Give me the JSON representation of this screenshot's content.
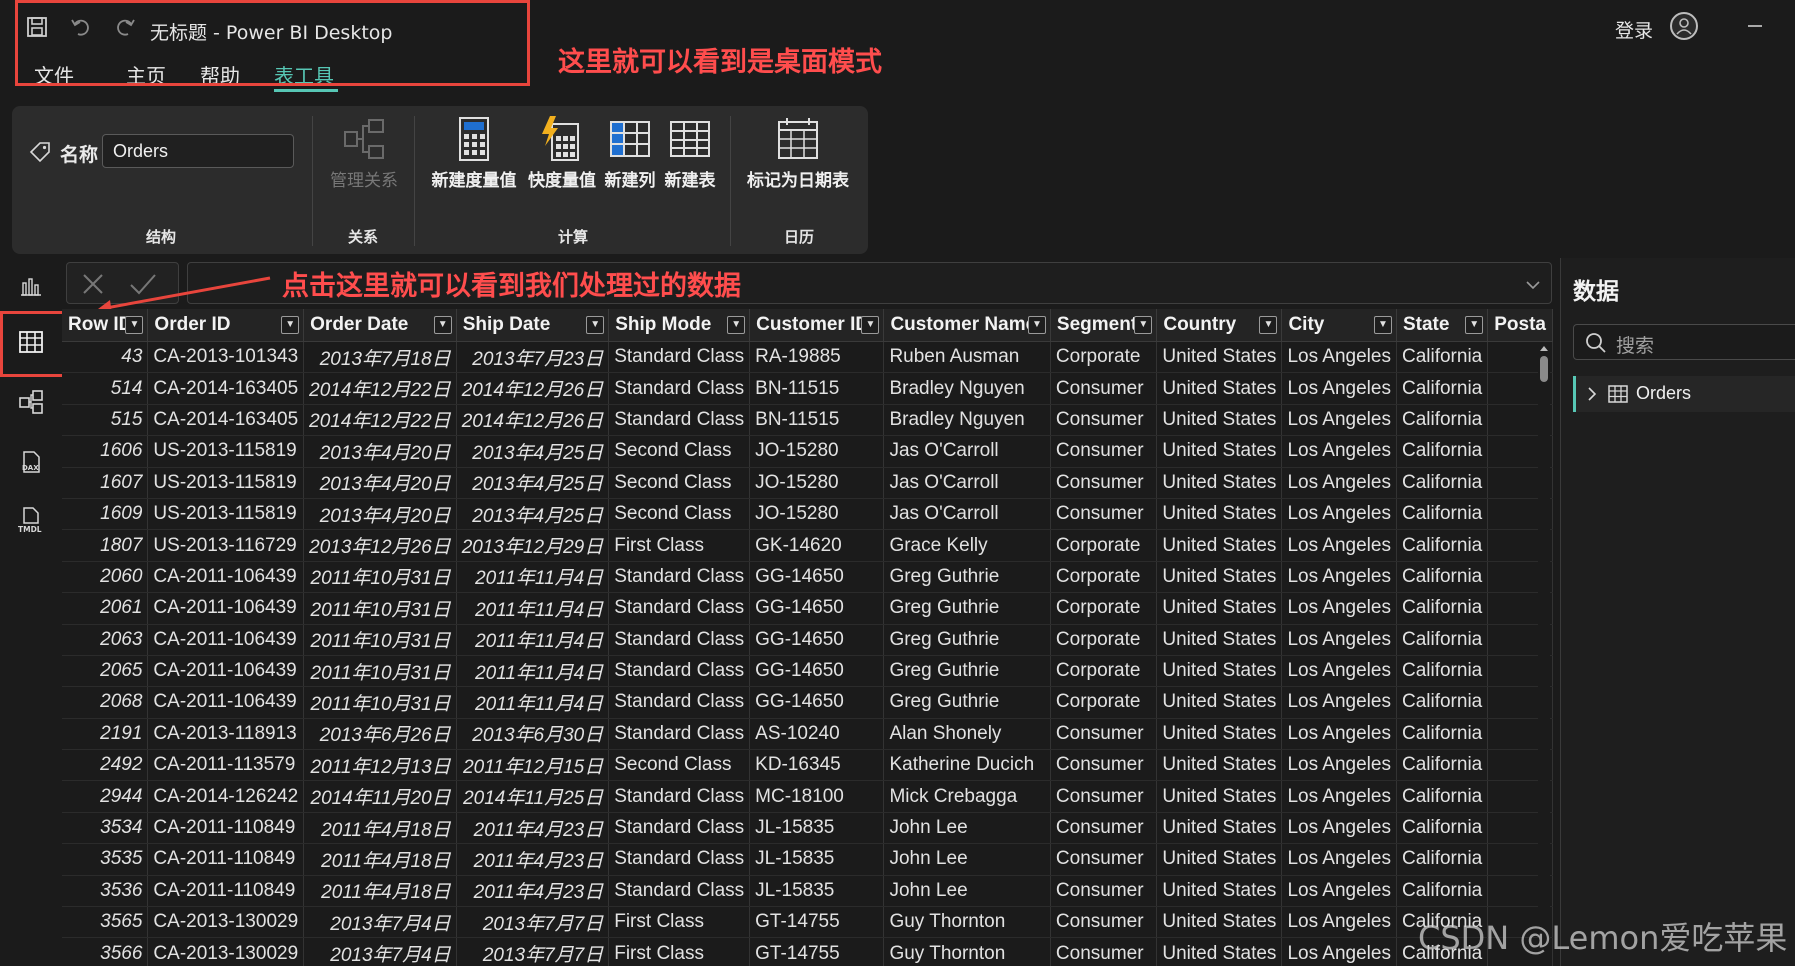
{
  "titlebar": {
    "app_title": "无标题 - Power BI Desktop",
    "login": "登录",
    "menu": [
      "文件",
      "主页",
      "帮助",
      "表工具"
    ]
  },
  "annotations": {
    "desktop_mode": "这里就可以看到是桌面模式",
    "click_here": "点击这里就可以看到我们处理过的数据"
  },
  "ribbon": {
    "name_label": "名称",
    "name_value": "Orders",
    "buttons": {
      "manage_relations": "管理关系",
      "new_measure": "新建度量值",
      "quick_measure": "快度量值",
      "new_column": "新建列",
      "new_table": "新建表",
      "mark_date": "标记为日期表"
    },
    "groups": {
      "structure": "结构",
      "relations": "关系",
      "calc": "计算",
      "calendar": "日历"
    }
  },
  "right_panel": {
    "title": "数据",
    "search_placeholder": "搜索",
    "table_name": "Orders"
  },
  "grid": {
    "columns": [
      "Row ID",
      "Order ID",
      "Order Date",
      "Ship Date",
      "Ship Mode",
      "Customer ID",
      "Customer Name",
      "Segment",
      "Country",
      "City",
      "State",
      "Posta"
    ],
    "rows": [
      [
        "43",
        "CA-2013-101343",
        "2013年7月18日",
        "2013年7月23日",
        "Standard Class",
        "RA-19885",
        "Ruben Ausman",
        "Corporate",
        "United States",
        "Los Angeles",
        "California"
      ],
      [
        "514",
        "CA-2014-163405",
        "2014年12月22日",
        "2014年12月26日",
        "Standard Class",
        "BN-11515",
        "Bradley Nguyen",
        "Consumer",
        "United States",
        "Los Angeles",
        "California"
      ],
      [
        "515",
        "CA-2014-163405",
        "2014年12月22日",
        "2014年12月26日",
        "Standard Class",
        "BN-11515",
        "Bradley Nguyen",
        "Consumer",
        "United States",
        "Los Angeles",
        "California"
      ],
      [
        "1606",
        "US-2013-115819",
        "2013年4月20日",
        "2013年4月25日",
        "Second Class",
        "JO-15280",
        "Jas O'Carroll",
        "Consumer",
        "United States",
        "Los Angeles",
        "California"
      ],
      [
        "1607",
        "US-2013-115819",
        "2013年4月20日",
        "2013年4月25日",
        "Second Class",
        "JO-15280",
        "Jas O'Carroll",
        "Consumer",
        "United States",
        "Los Angeles",
        "California"
      ],
      [
        "1609",
        "US-2013-115819",
        "2013年4月20日",
        "2013年4月25日",
        "Second Class",
        "JO-15280",
        "Jas O'Carroll",
        "Consumer",
        "United States",
        "Los Angeles",
        "California"
      ],
      [
        "1807",
        "US-2013-116729",
        "2013年12月26日",
        "2013年12月29日",
        "First Class",
        "GK-14620",
        "Grace Kelly",
        "Corporate",
        "United States",
        "Los Angeles",
        "California"
      ],
      [
        "2060",
        "CA-2011-106439",
        "2011年10月31日",
        "2011年11月4日",
        "Standard Class",
        "GG-14650",
        "Greg Guthrie",
        "Corporate",
        "United States",
        "Los Angeles",
        "California"
      ],
      [
        "2061",
        "CA-2011-106439",
        "2011年10月31日",
        "2011年11月4日",
        "Standard Class",
        "GG-14650",
        "Greg Guthrie",
        "Corporate",
        "United States",
        "Los Angeles",
        "California"
      ],
      [
        "2063",
        "CA-2011-106439",
        "2011年10月31日",
        "2011年11月4日",
        "Standard Class",
        "GG-14650",
        "Greg Guthrie",
        "Corporate",
        "United States",
        "Los Angeles",
        "California"
      ],
      [
        "2065",
        "CA-2011-106439",
        "2011年10月31日",
        "2011年11月4日",
        "Standard Class",
        "GG-14650",
        "Greg Guthrie",
        "Corporate",
        "United States",
        "Los Angeles",
        "California"
      ],
      [
        "2068",
        "CA-2011-106439",
        "2011年10月31日",
        "2011年11月4日",
        "Standard Class",
        "GG-14650",
        "Greg Guthrie",
        "Corporate",
        "United States",
        "Los Angeles",
        "California"
      ],
      [
        "2191",
        "CA-2013-118913",
        "2013年6月26日",
        "2013年6月30日",
        "Standard Class",
        "AS-10240",
        "Alan Shonely",
        "Consumer",
        "United States",
        "Los Angeles",
        "California"
      ],
      [
        "2492",
        "CA-2011-113579",
        "2011年12月13日",
        "2011年12月15日",
        "Second Class",
        "KD-16345",
        "Katherine Ducich",
        "Consumer",
        "United States",
        "Los Angeles",
        "California"
      ],
      [
        "2944",
        "CA-2014-126242",
        "2014年11月20日",
        "2014年11月25日",
        "Standard Class",
        "MC-18100",
        "Mick Crebagga",
        "Consumer",
        "United States",
        "Los Angeles",
        "California"
      ],
      [
        "3534",
        "CA-2011-110849",
        "2011年4月18日",
        "2011年4月23日",
        "Standard Class",
        "JL-15835",
        "John Lee",
        "Consumer",
        "United States",
        "Los Angeles",
        "California"
      ],
      [
        "3535",
        "CA-2011-110849",
        "2011年4月18日",
        "2011年4月23日",
        "Standard Class",
        "JL-15835",
        "John Lee",
        "Consumer",
        "United States",
        "Los Angeles",
        "California"
      ],
      [
        "3536",
        "CA-2011-110849",
        "2011年4月18日",
        "2011年4月23日",
        "Standard Class",
        "JL-15835",
        "John Lee",
        "Consumer",
        "United States",
        "Los Angeles",
        "California"
      ],
      [
        "3565",
        "CA-2013-130029",
        "2013年7月4日",
        "2013年7月7日",
        "First Class",
        "GT-14755",
        "Guy Thornton",
        "Consumer",
        "United States",
        "Los Angeles",
        "California"
      ],
      [
        "3566",
        "CA-2013-130029",
        "2013年7月4日",
        "2013年7月7日",
        "First Class",
        "GT-14755",
        "Guy Thornton",
        "Consumer",
        "United States",
        "Los Angeles",
        "California"
      ]
    ]
  },
  "watermark": "CSDN @Lemon爱吃苹果",
  "colors": {
    "accent": "#57c7b5",
    "annotation": "#e8453c",
    "background": "#1b1b1b"
  }
}
